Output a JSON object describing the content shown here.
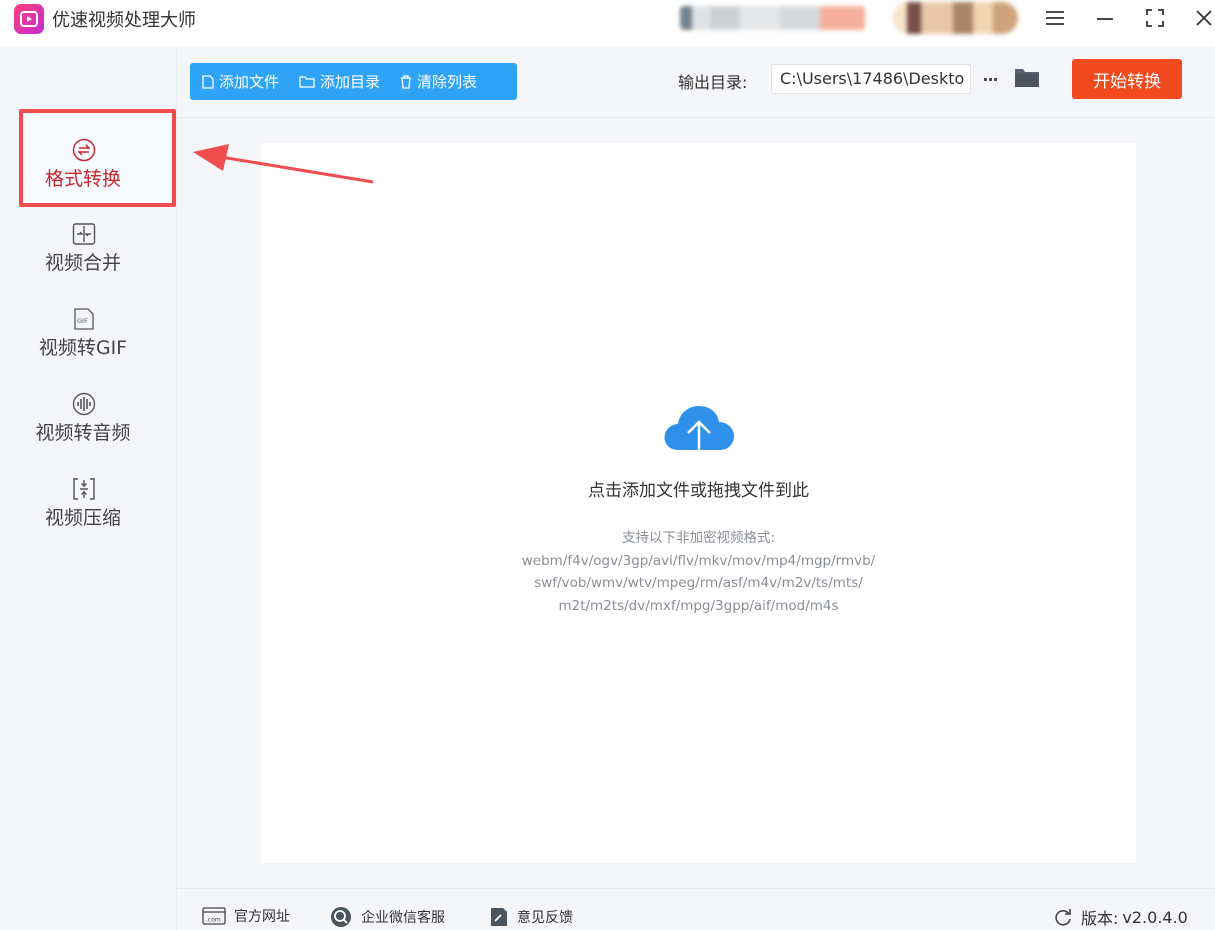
{
  "app": {
    "title": "优速视频处理大师"
  },
  "sidebar": {
    "items": [
      {
        "label": "格式转换",
        "icon": "format-convert-icon",
        "active": true
      },
      {
        "label": "视频合并",
        "icon": "video-merge-icon"
      },
      {
        "label": "视频转GIF",
        "icon": "gif-icon"
      },
      {
        "label": "视频转音频",
        "icon": "audio-wave-icon"
      },
      {
        "label": "视频压缩",
        "icon": "compress-icon"
      }
    ]
  },
  "toolbar": {
    "add_file": "添加文件",
    "add_dir": "添加目录",
    "clear_list": "清除列表",
    "output_label": "输出目录:",
    "output_path": "C:\\Users\\17486\\Deskto",
    "more": "···",
    "start": "开始转换"
  },
  "dropzone": {
    "main_text": "点击添加文件或拖拽文件到此",
    "support_title": "支持以下非加密视频格式:",
    "formats_line1": "webm/f4v/ogv/3gp/avi/flv/mkv/mov/mp4/mgp/rmvb/",
    "formats_line2": "swf/vob/wmv/wtv/mpeg/rm/asf/m4v/m2v/ts/mts/",
    "formats_line3": "m2t/m2ts/dv/mxf/mpg/3gpp/aif/mod/m4s"
  },
  "footer": {
    "website": "官方网址",
    "wechat": "企业微信客服",
    "feedback": "意见反馈",
    "version_label": "版本:",
    "version": "v2.0.4.0"
  },
  "colors": {
    "accent_blue": "#2fa4f6",
    "start_orange": "#f04a1e",
    "active_red": "#c8262c",
    "highlight_red": "#f04e4e"
  }
}
